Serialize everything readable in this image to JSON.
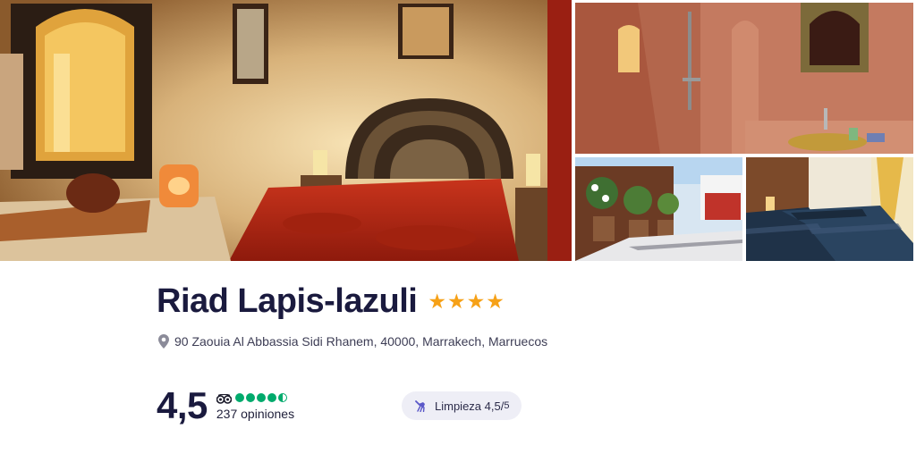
{
  "gallery": {
    "photos": [
      {
        "name": "photo-bedroom"
      },
      {
        "name": "photo-bathroom"
      },
      {
        "name": "photo-terrace"
      },
      {
        "name": "photo-twin-room"
      }
    ]
  },
  "hotel": {
    "name": "Riad Lapis-lazuli",
    "star_count": 4,
    "star_glyph": "★",
    "star_color": "#f6a117",
    "address": "90 Zaouia Al Abbassia Sidi Rhanem, 40000, Marrakech, Marruecos"
  },
  "rating": {
    "score": "4,5",
    "tripadvisor_bubbles": 4.5,
    "bubble_color": "#00aa6c",
    "reviews": "237 opiniones"
  },
  "badge": {
    "label": "Limpieza 4,5",
    "separator": "/",
    "max": "5",
    "icon": "broom-icon"
  },
  "colors": {
    "title": "#1a1a3e",
    "badge_bg": "#eeeef6"
  }
}
